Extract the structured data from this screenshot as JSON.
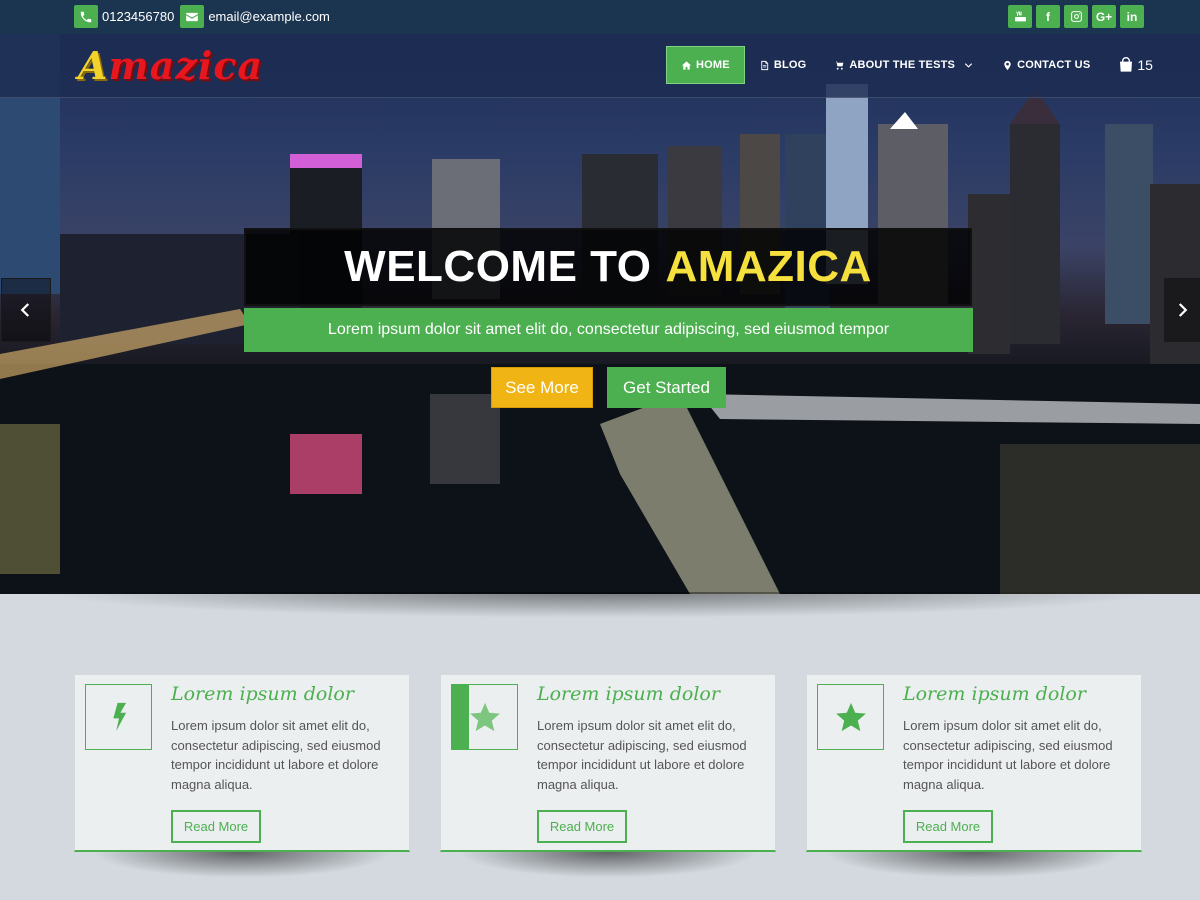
{
  "topbar": {
    "phone": "0123456780",
    "email": "email@example.com",
    "social": [
      {
        "icon": "youtube-icon"
      },
      {
        "icon": "facebook-icon",
        "glyph": "f"
      },
      {
        "icon": "instagram-icon"
      },
      {
        "icon": "google-plus-icon",
        "glyph": "G+"
      },
      {
        "icon": "linkedin-icon",
        "glyph": "in"
      }
    ]
  },
  "brand": {
    "logo_first": "A",
    "logo_rest": "mazica"
  },
  "nav": {
    "items": [
      {
        "label": "Home",
        "icon": "home-icon",
        "active": true
      },
      {
        "label": "Blog",
        "icon": "document-icon"
      },
      {
        "label": "About The Tests",
        "icon": "cart-icon",
        "has_dropdown": true
      },
      {
        "label": "Contact Us",
        "icon": "map-marker-icon"
      }
    ],
    "cart_count": "15"
  },
  "hero": {
    "title_white": "WELCOME TO",
    "title_yellow": "AMAZICA",
    "subtitle": "Lorem ipsum dolor sit amet elit do, consectetur adipiscing, sed eiusmod tempor",
    "btn_see_more": "See More",
    "btn_get_started": "Get Started"
  },
  "features": [
    {
      "icon": "bolt-icon",
      "title": "Lorem ipsum dolor",
      "text": "Lorem ipsum dolor sit amet elit do, consectetur adipiscing, sed eiusmod tempor incididunt ut labore et dolore magna aliqua.",
      "button": "Read More"
    },
    {
      "icon": "star-icon",
      "title": "Lorem ipsum dolor",
      "text": "Lorem ipsum dolor sit amet elit do, consectetur adipiscing, sed eiusmod tempor incididunt ut labore et dolore magna aliqua.",
      "button": "Read More"
    },
    {
      "icon": "star-icon",
      "title": "Lorem ipsum dolor",
      "text": "Lorem ipsum dolor sit amet elit do, consectetur adipiscing, sed eiusmod tempor incididunt ut labore et dolore magna aliqua.",
      "button": "Read More"
    }
  ],
  "colors": {
    "accent": "#4caf50",
    "topbar": "#1b3550",
    "highlight": "#f5e03d",
    "button_yellow": "#f0b414"
  }
}
